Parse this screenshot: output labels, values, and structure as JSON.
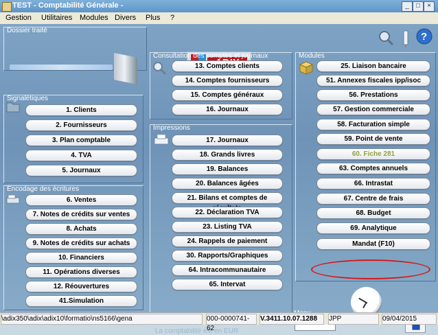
{
  "window": {
    "title": "TEST - Comptabilité Générale -",
    "controls": [
      "_",
      "□",
      "×"
    ]
  },
  "menu": [
    "Gestion",
    "Utilitaires",
    "Modules",
    "Divers",
    "Plus",
    "?"
  ],
  "dossier": {
    "title": "Dossier traité"
  },
  "logo": {
    "text": "ADIX",
    "colors": [
      "#c31f27",
      "#2b8ed8",
      "#45a84a",
      "#f0c12f"
    ]
  },
  "groups": {
    "signaletiques": {
      "title": "Signalétiques",
      "buttons": [
        "1. Clients",
        "2. Fournisseurs",
        "3. Plan comptable",
        "4. TVA",
        "5. Journaux"
      ]
    },
    "encodage": {
      "title": "Encodage des écritures",
      "buttons": [
        "6. Ventes",
        "7. Notes de crédits sur ventes",
        "8. Achats",
        "9. Notes de crédits sur achats",
        "10.  Financiers",
        "11. Opérations diverses",
        "12. Réouvertures",
        "41.Simulation"
      ]
    },
    "consultation": {
      "title": "Consultation des comptes et journaux",
      "buttons": [
        "13. Comptes clients",
        "14. Comptes fournisseurs",
        "15. Comptes généraux",
        "16. Journaux"
      ]
    },
    "impressions": {
      "title": "Impressions",
      "buttons": [
        "17. Journaux",
        "18. Grands livres",
        "19. Balances",
        "20. Balances âgées",
        "21. Bilans et comptes de résultats",
        "22. Déclaration TVA",
        "23. Listing TVA",
        "24. Rappels de paiement",
        "30. Rapports/Graphiques",
        "64. Intracommunautaire",
        "65. Intervat"
      ]
    },
    "modules": {
      "title": "Modules",
      "buttons": [
        "25. Liaison bancaire",
        "51. Annexes fiscales ipp/isoc",
        "56. Prestations",
        "57. Gestion commerciale",
        "58. Facturation simple",
        "59. Point de vente",
        "60. Fiche 281",
        "63.  Comptes annuels",
        "66. Intrastat",
        "67. Centre de frais",
        "68. Budget",
        "69. Analytique",
        "Mandat (F10)"
      ]
    }
  },
  "menu_field": {
    "label": "Menu",
    "value": ""
  },
  "footer_note": "La comptabilité est en EUR",
  "status_bar": {
    "path": "\\adix350\\adix\\adix10\\formatio\\ns5166\\gena",
    "code": "000-0000741-62",
    "version": "V.3411.10.07.1288",
    "user": "JPP",
    "date": "09/04/2015"
  },
  "icons": [
    "app-icon",
    "search-icon",
    "pen-icon",
    "help-icon",
    "folder-icon",
    "scanner-icon",
    "printer-icon",
    "box-icon",
    "clock-icon",
    "exit-icon"
  ]
}
